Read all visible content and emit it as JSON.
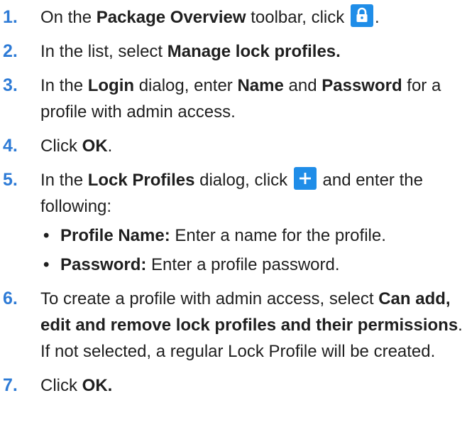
{
  "colors": {
    "step_number": "#2e7bd6",
    "icon_button_bg": "#1f8de8",
    "text": "#1f1f1f"
  },
  "steps": [
    {
      "number": "1.",
      "t1": "On the ",
      "b1": "Package Overview",
      "t2": " toolbar, click ",
      "icon": "lock-icon",
      "t3": "."
    },
    {
      "number": "2.",
      "t1": "In the list, select ",
      "b1": "Manage lock profiles."
    },
    {
      "number": "3.",
      "t1": "In the ",
      "b1": "Login",
      "t2": " dialog, enter ",
      "b2": "Name",
      "t3": " and ",
      "b3": "Password",
      "t4": " for a profile with admin access."
    },
    {
      "number": "4.",
      "t1": "Click ",
      "b1": "OK",
      "t2": "."
    },
    {
      "number": "5.",
      "t1": "In the ",
      "b1": "Lock Profiles",
      "t2": " dialog, click ",
      "icon": "plus-icon",
      "t3": " and enter the following:",
      "bullets": [
        {
          "dot": "•",
          "label": "Profile Name:",
          "text": " Enter a name for the profile."
        },
        {
          "dot": "•",
          "label": "Password:",
          "text": " Enter a profile password."
        }
      ]
    },
    {
      "number": "6.",
      "t1": "To create a profile with admin access, select ",
      "b1": "Can add, edit and remove lock profiles and their permissions",
      "t2": ". If not selected, a regular Lock Profile will be created."
    },
    {
      "number": "7.",
      "t1": "Click ",
      "b1": "OK."
    }
  ]
}
